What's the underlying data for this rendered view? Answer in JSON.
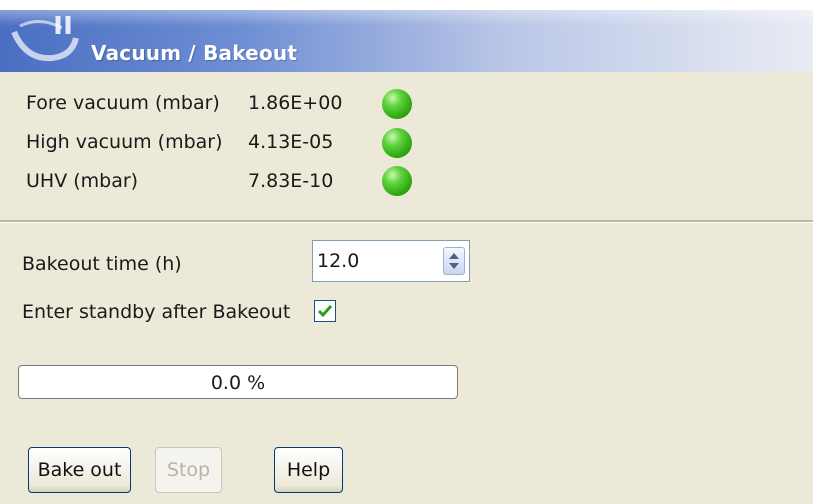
{
  "window": {
    "title": "Vacuum / Bakeout"
  },
  "vacuum": [
    {
      "label": "Fore vacuum (mbar)",
      "value": "1.86E+00",
      "status_color": "#3cbc1c"
    },
    {
      "label": "High vacuum (mbar)",
      "value": "4.13E-05",
      "status_color": "#3cbc1c"
    },
    {
      "label": "UHV (mbar)",
      "value": "7.83E-10",
      "status_color": "#3cbc1c"
    }
  ],
  "bakeout": {
    "time_label": "Bakeout time (h)",
    "time_value": "12.0",
    "standby_label": "Enter standby after Bakeout",
    "standby_checked": true
  },
  "progress": {
    "text": "0.0 %",
    "fraction": 0.0
  },
  "buttons": {
    "bake_out": "Bake out",
    "stop": "Stop",
    "help": "Help"
  },
  "colors": {
    "titlebar_start": "#4a6fc2",
    "led_green": "#3cbc1c",
    "checkmark": "#21a121"
  }
}
